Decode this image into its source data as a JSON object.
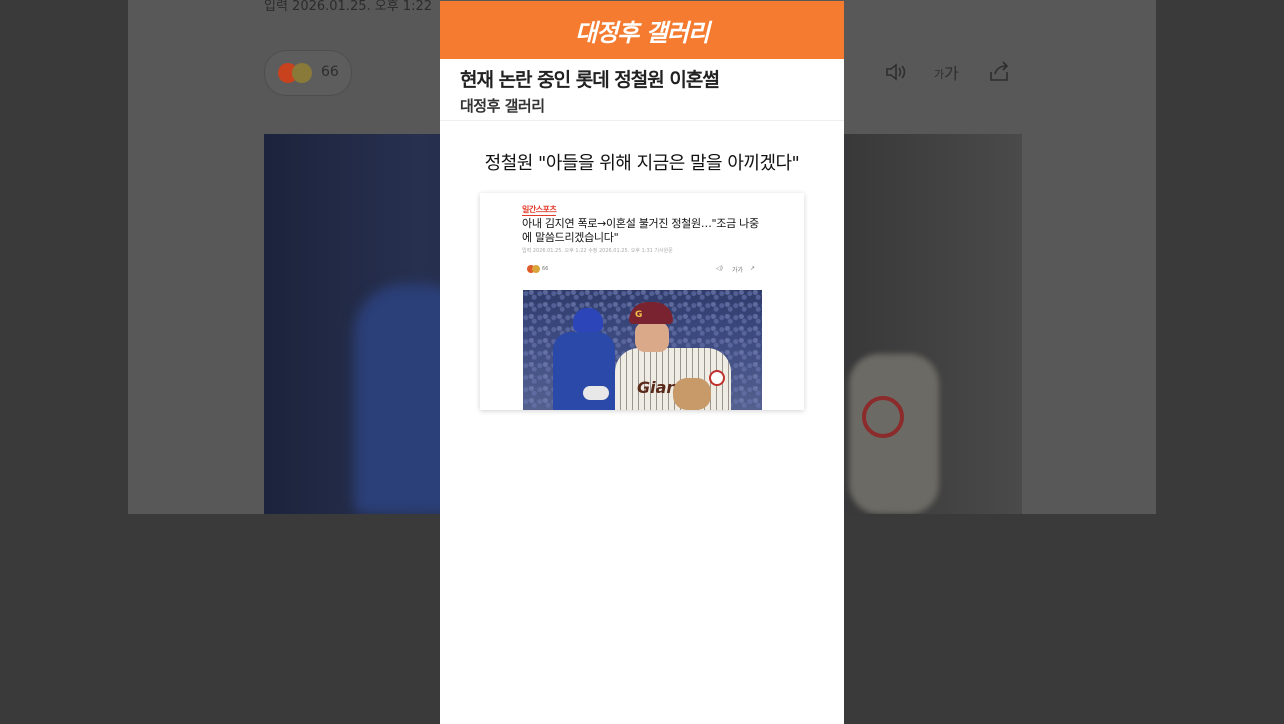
{
  "background": {
    "dateline": "입력 2026.01.25. 오후 1:22",
    "reaction_count": "66"
  },
  "panel": {
    "brand_title": "대정후 갤러리",
    "post_title": "현재 논란 중인 롯데 정철원 이혼썰",
    "post_author": "대정후 갤러리",
    "quote_heading": "정철원 \"아들을 위해 지금은 말을 아끼겠다\""
  },
  "news_card": {
    "source_logo": "일간스포츠",
    "headline": "아내 김지연 폭로→이혼설 불거진 정철원…\"조금 나중에 말씀드리겠습니다\"",
    "dateline": "입력 2026.01.25. 오후 1:22   수정 2026.01.25. 오후 1:31   기사원문",
    "reaction_count": "66",
    "font_button": "가가",
    "photo_team_text": "Giants",
    "photo_cap_text": "G"
  },
  "colors": {
    "brand_orange": "#f47b30",
    "overlay_dark": "#3a3a3a"
  },
  "icons": [
    "speaker-icon",
    "font-size-icon",
    "share-icon"
  ]
}
